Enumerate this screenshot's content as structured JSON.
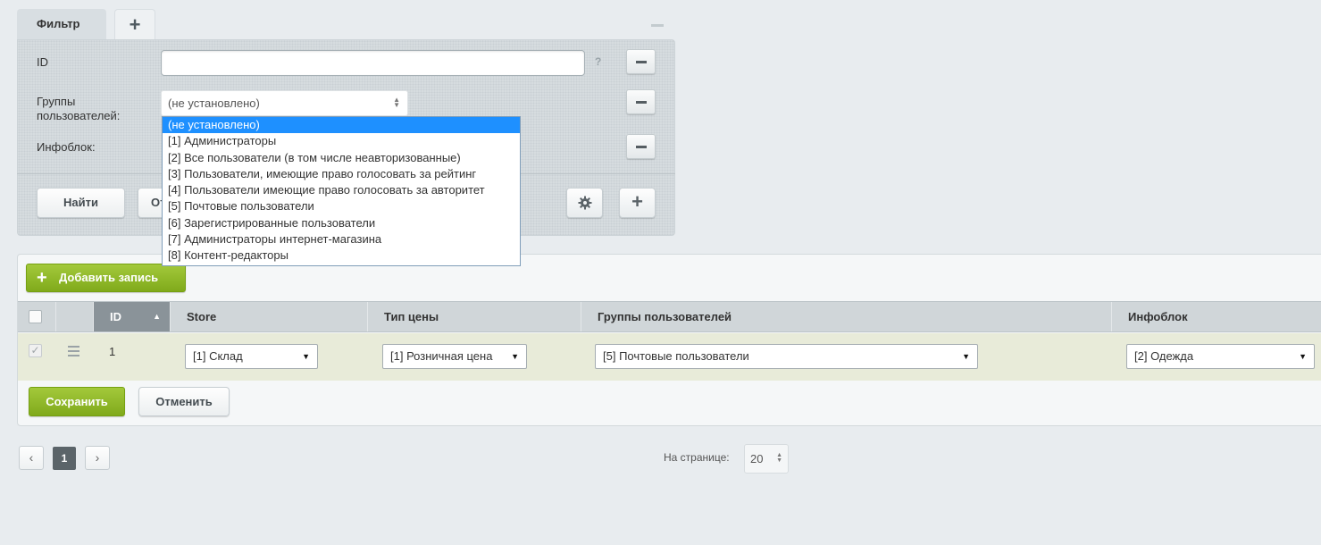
{
  "filter": {
    "tab_label": "Фильтр",
    "add_tab_label": "+",
    "help_mark": "?",
    "fields": {
      "id_label": "ID",
      "id_value": "",
      "groups_label": "Группы пользователей:",
      "groups_selected": "(не установлено)",
      "iblock_label": "Инфоблок:"
    },
    "dropdown_options": [
      "(не установлено)",
      "[1] Администраторы",
      "[2] Все пользователи (в том числе неавторизованные)",
      "[3] Пользователи, имеющие право голосовать за рейтинг",
      "[4] Пользователи имеющие право голосовать за авторитет",
      "[5] Почтовые пользователи",
      "[6] Зарегистрированные пользователи",
      "[7] Администраторы интернет-магазина",
      "[8] Контент-редакторы"
    ],
    "find_label": "Найти",
    "cancel_label_partial": "От",
    "settings_icon": "gear-icon",
    "add_field_icon": "plus-icon"
  },
  "grid": {
    "add_record_label": "Добавить запись",
    "columns": {
      "id": "ID",
      "store": "Store",
      "price_type": "Тип цены",
      "user_groups": "Группы пользователей",
      "iblock": "Инфоблок"
    },
    "row": {
      "id": "1",
      "store": "[1] Склад",
      "price_type": "[1] Розничная цена",
      "user_groups": "[5] Почтовые пользователи",
      "iblock": "[2] Одежда"
    },
    "save_label": "Сохранить",
    "cancel_label": "Отменить"
  },
  "pagination": {
    "prev": "‹",
    "current_page": "1",
    "next": "›",
    "per_page_label": "На странице:",
    "per_page_value": "20"
  },
  "colors": {
    "accent_green": "#86b01f",
    "selected_option": "#1e90ff",
    "row_edit_bg": "#e8ebd9"
  }
}
